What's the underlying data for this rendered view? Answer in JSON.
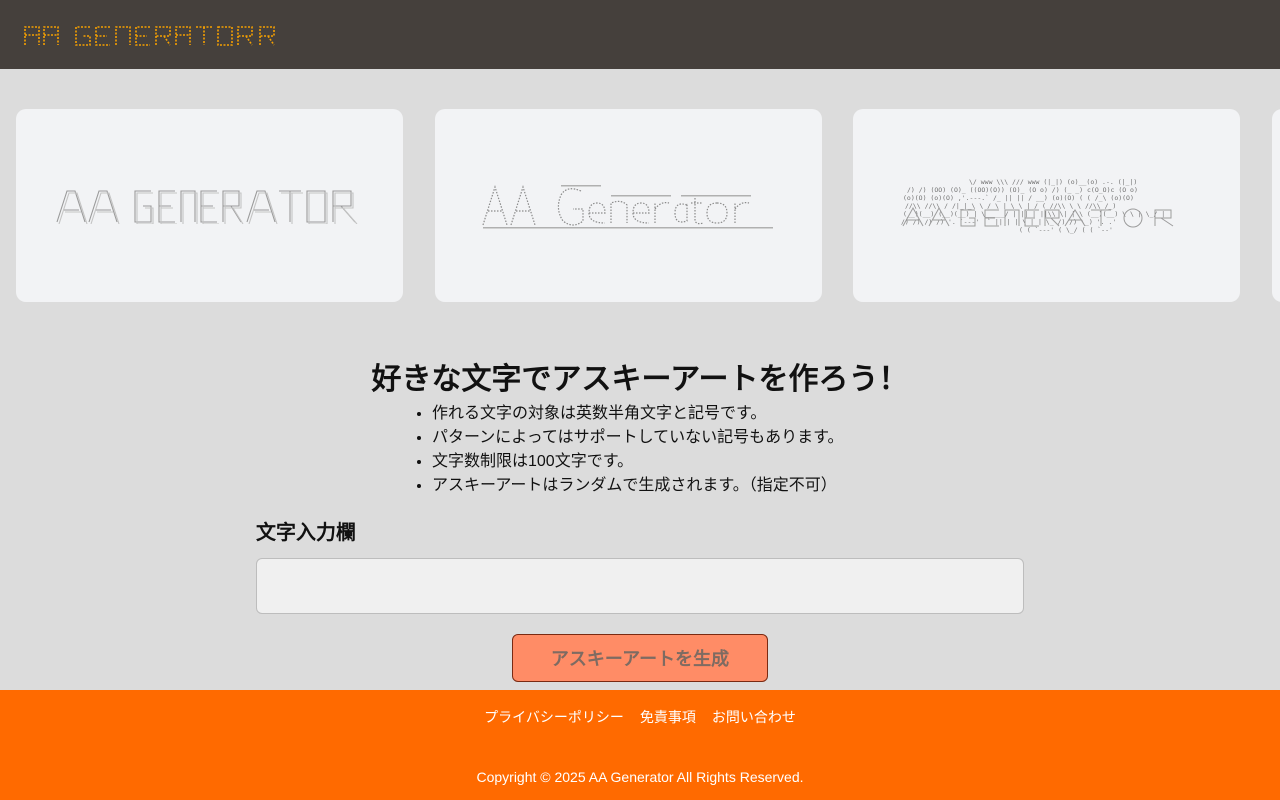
{
  "header": {
    "logo_text": "AA GENERATOR",
    "logo_icon": "dashed-ascii-logo"
  },
  "carousel": {
    "items": [
      {
        "alt": "AA GENERATOR",
        "style": "outline-ascii"
      },
      {
        "alt": "AA Generator",
        "style": "dense-ascii"
      },
      {
        "alt": "AA GENERATOR",
        "style": "character-ascii"
      },
      {
        "alt": "",
        "style": "partial-card"
      }
    ]
  },
  "main": {
    "title": "好きな文字でアスキーアートを作ろう！",
    "rules": [
      "作れる文字の対象は英数半角文字と記号です。",
      "パターンによってはサポートしていない記号もあります。",
      "文字数制限は100文字です。",
      "アスキーアートはランダムで生成されます。（指定不可）"
    ]
  },
  "form": {
    "label": "文字入力欄",
    "input_value": "",
    "input_placeholder": "",
    "button_label": "アスキーアートを生成"
  },
  "footer": {
    "links": [
      "プライバシーポリシー",
      "免責事項",
      "お問い合わせ"
    ],
    "copyright": "Copyright © 2025 AA Generator All Rights Reserved."
  },
  "colors": {
    "header_bg": "#45403c",
    "logo": "#f5a000",
    "page_bg": "#dcdcdc",
    "card_bg": "#f2f3f5",
    "button_bg": "#ff8c66",
    "footer_bg": "#ff6a00"
  }
}
